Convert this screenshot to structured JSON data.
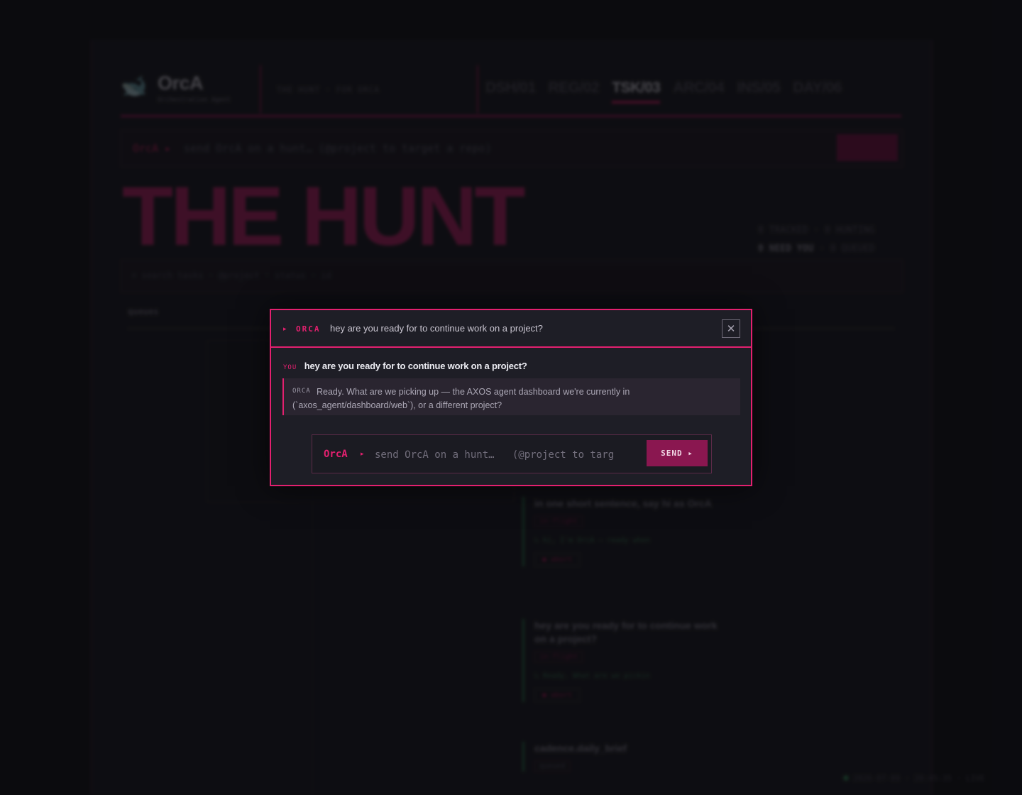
{
  "app": {
    "logo_glyph": "🐋",
    "title": "OrcA",
    "subtitle": "Orchestration Agent",
    "crumb": "THE HUNT · FOR ORCA",
    "nav": [
      "DSH/01",
      "REG/02",
      "TSK/03",
      "ARC/04",
      "INS/05",
      "DAY/06"
    ],
    "active_nav_index": 2,
    "command_bar": {
      "prompt": "OrcA ▸",
      "placeholder": "send OrcA on a hunt…   (@project to target a repo)"
    },
    "hero_title": "THE HUNT",
    "stats": {
      "line1": "0 TRACKED · 0 HUNTING",
      "need_you": "0 NEED YOU",
      "line2_rest": " · 0 QUEUED"
    },
    "filter_hint": "⌕ search tasks · @project · status · id",
    "column_left": "queues",
    "cards": [
      {
        "title": "in one short sentence, say hi as OrcA",
        "tag": "in-flight",
        "log": "↳ hi, I'm OrcA — ready when",
        "action": "◼ abort"
      },
      {
        "title": "hey are you ready for to continue work on a project?",
        "tag": "in-flight",
        "log": "↳ Ready. What are we pickin",
        "action": "◼ abort"
      },
      {
        "title": "cadence.daily_brief",
        "tag": "queued"
      }
    ],
    "footer_status": "2026-07-09 · 20:45:35 · LIVE",
    "accent_color": "#e3206f",
    "success_color": "#2e7d4f"
  },
  "modal": {
    "arrow": "▸",
    "brand": "ORCA",
    "title": "hey are you ready for to continue work on a project?",
    "close_icon": "close-icon",
    "close_glyph": "✕",
    "you_label": "YOU",
    "you_text": "hey are you ready for to continue work on a project?",
    "orca_label": "ORCA",
    "reply": "Ready. What are we picking up — the AXOS agent dashboard we're currently in (`axos_agent/dashboard/web`), or a different project?",
    "composer": {
      "prompt": "OrcA",
      "caret": "▸",
      "placeholder": "send OrcA on a hunt…   (@project to targ",
      "value": "",
      "send_label": "SEND ▸"
    }
  }
}
